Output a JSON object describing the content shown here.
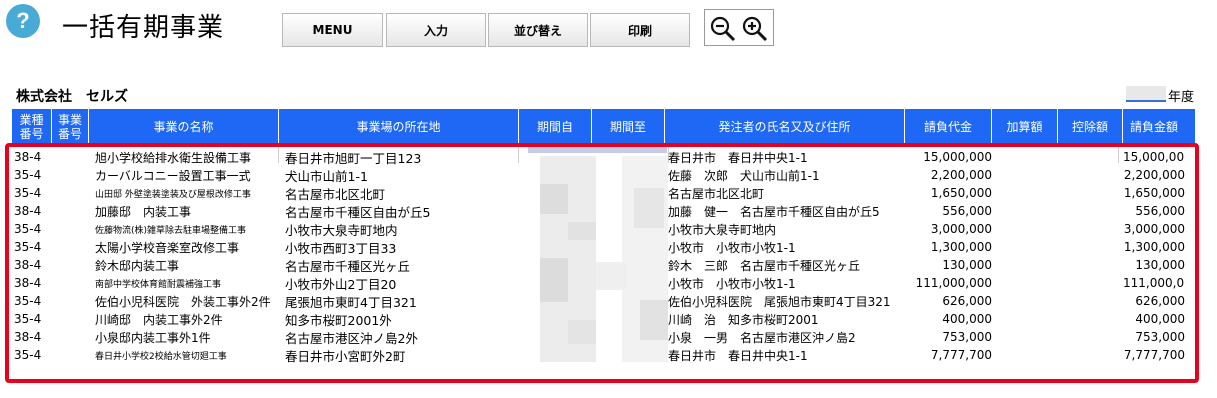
{
  "header": {
    "help_glyph": "?",
    "title": "一括有期事業",
    "buttons": {
      "menu": "MENU",
      "input": "入力",
      "sort": "並び替え",
      "print": "印刷"
    },
    "zoom_out_icon": "zoom-out-icon",
    "zoom_in_icon": "zoom-in-icon"
  },
  "company": "株式会社　セルズ",
  "year": {
    "value": "",
    "label": "年度"
  },
  "table": {
    "columns": {
      "kind": "業種\n番号",
      "jno": "事業\n番号",
      "name": "事業の名称",
      "addr": "事業場の所在地",
      "from": "期間自",
      "to": "期間至",
      "client": "発注者の氏名又及び住所",
      "contract": "請負代金",
      "add": "加算額",
      "ded": "控除額",
      "total": "請負金額"
    },
    "rows": [
      {
        "kind": "38-4",
        "name": "旭小学校給排水衛生設備工事",
        "addr": "春日井市旭町一丁目123",
        "client": "春日井市　春日井中央1-1",
        "contract": "15,000,000",
        "total": "15,000,000"
      },
      {
        "kind": "35-4",
        "name": "カーバルコニー設置工事一式",
        "addr": "犬山市山前1-1",
        "client": "佐藤　次郎　犬山市山前1-1",
        "contract": "2,200,000",
        "total": "2,200,000"
      },
      {
        "kind": "35-4",
        "name": "山田邸 外壁塗装塗装及び屋根改修工事",
        "addr": "名古屋市北区北町",
        "client": "名古屋市北区北町",
        "contract": "1,650,000",
        "total": "1,650,000",
        "small": true
      },
      {
        "kind": "38-4",
        "name": "加藤邸　内装工事",
        "addr": "名古屋市千種区自由が丘5",
        "client": "加藤　健一　名古屋市千種区自由が丘5",
        "contract": "556,000",
        "total": "556,000"
      },
      {
        "kind": "35-4",
        "name": "佐藤物流(株)雑草除去駐車場整備工事",
        "addr": "小牧市大泉寺町地内",
        "client": "小牧市大泉寺町地内",
        "contract": "3,000,000",
        "total": "3,000,000",
        "small": true
      },
      {
        "kind": "35-4",
        "name": "太陽小学校音楽室改修工事",
        "addr": "小牧市西町3丁目33",
        "client": "小牧市　小牧市小牧1-1",
        "contract": "1,300,000",
        "total": "1,300,000"
      },
      {
        "kind": "38-4",
        "name": "鈴木邸内装工事",
        "addr": "名古屋市千種区光ヶ丘",
        "client": "鈴木　三郎　名古屋市千種区光ヶ丘",
        "contract": "130,000",
        "total": "130,000"
      },
      {
        "kind": "38-4",
        "name": "南部中学校体育館耐震補強工事",
        "addr": "小牧市外山2丁目20",
        "client": "小牧市　小牧市小牧1-1",
        "contract": "111,000,000",
        "total": "111,000,000",
        "small": true
      },
      {
        "kind": "35-4",
        "name": "佐伯小児科医院　外装工事外2件",
        "addr": "尾張旭市東町4丁目321",
        "client": "佐伯小児科医院　尾張旭市東町4丁目321",
        "contract": "626,000",
        "total": "626,000"
      },
      {
        "kind": "35-4",
        "name": "川崎邸　内装工事外2件",
        "addr": "知多市桜町2001外",
        "client": "川崎　治　知多市桜町2001",
        "contract": "400,000",
        "total": "400,000"
      },
      {
        "kind": "38-4",
        "name": "小泉邸内装工事外1件",
        "addr": "名古屋市港区沖ノ島2外",
        "client": "小泉　一男　名古屋市港区沖ノ島2",
        "contract": "753,000",
        "total": "753,000"
      },
      {
        "kind": "35-4",
        "name": "春日井小学校2校給水管切廻工事",
        "addr": "春日井市小宮町外2町",
        "client": "春日井市　春日井中央1-1",
        "contract": "7,777,700",
        "total": "7,777,700",
        "small": true
      }
    ]
  }
}
